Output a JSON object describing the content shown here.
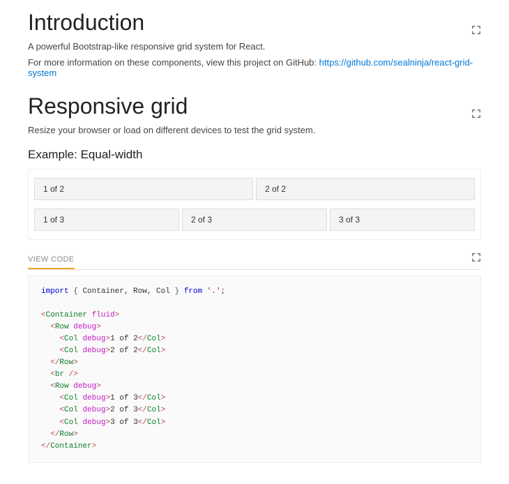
{
  "intro": {
    "heading": "Introduction",
    "p1": "A powerful Bootstrap-like responsive grid system for React.",
    "p2_prefix": "For more information on these components, view this project on GitHub: ",
    "link_text": "https://github.com/sealninja/react-grid-system"
  },
  "grid": {
    "heading": "Responsive grid",
    "p1": "Resize your browser or load on different devices to test the grid system.",
    "example_heading": "Example: Equal-width",
    "rows": [
      [
        "1 of 2",
        "2 of 2"
      ],
      [
        "1 of 3",
        "2 of 3",
        "3 of 3"
      ]
    ]
  },
  "viewcode_label": "VIEW CODE",
  "code": {
    "import_kw": "import",
    "import_names": "Container, Row, Col",
    "from_kw": "from",
    "module": "'.'",
    "container": "Container",
    "row": "Row",
    "col": "Col",
    "fluid": "fluid",
    "debug": "debug",
    "br": "br",
    "c1": "1 of 2",
    "c2": "2 of 2",
    "c3": "1 of 3",
    "c4": "2 of 3",
    "c5": "3 of 3"
  }
}
